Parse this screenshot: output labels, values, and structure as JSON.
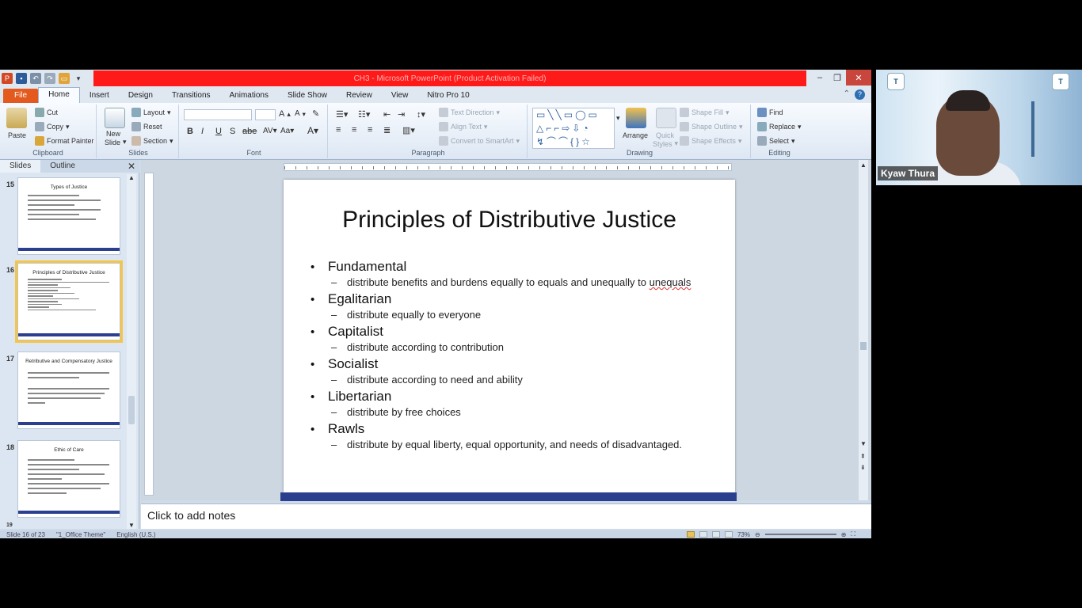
{
  "titlebar": {
    "title": "CH3 - Microsoft PowerPoint (Product Activation Failed)"
  },
  "tabs": [
    "File",
    "Home",
    "Insert",
    "Design",
    "Transitions",
    "Animations",
    "Slide Show",
    "Review",
    "View",
    "Nitro Pro 10"
  ],
  "ribbon": {
    "clipboard": {
      "label": "Clipboard",
      "paste": "Paste",
      "cut": "Cut",
      "copy": "Copy",
      "format_painter": "Format Painter"
    },
    "slides": {
      "label": "Slides",
      "new_slide_1": "New",
      "new_slide_2": "Slide",
      "layout": "Layout",
      "reset": "Reset",
      "section": "Section"
    },
    "font": {
      "label": "Font"
    },
    "paragraph": {
      "label": "Paragraph",
      "text_direction": "Text Direction",
      "align_text": "Align Text",
      "convert_smartart": "Convert to SmartArt"
    },
    "drawing": {
      "label": "Drawing",
      "arrange": "Arrange",
      "quick_styles_1": "Quick",
      "quick_styles_2": "Styles",
      "shape_fill": "Shape Fill",
      "shape_outline": "Shape Outline",
      "shape_effects": "Shape Effects"
    },
    "editing": {
      "label": "Editing",
      "find": "Find",
      "replace": "Replace",
      "select": "Select"
    }
  },
  "slides_panel": {
    "tab_slides": "Slides",
    "tab_outline": "Outline",
    "thumbnails": [
      {
        "number": "15",
        "title": "Types of Justice"
      },
      {
        "number": "16",
        "title": "Principles of Distributive Justice"
      },
      {
        "number": "17",
        "title": "Retributive and Compensatory Justice"
      },
      {
        "number": "18",
        "title": "Ethic of Care"
      },
      {
        "number": "19",
        "title": ""
      }
    ]
  },
  "slide": {
    "title": "Principles of Distributive Justice",
    "bullets": [
      {
        "head": "Fundamental",
        "sub": "distribute benefits and burdens equally to equals and unequally to ",
        "sub_flag": "unequals"
      },
      {
        "head": "Egalitarian",
        "sub": "distribute equally to everyone"
      },
      {
        "head": "Capitalist",
        "sub": "distribute according to contribution"
      },
      {
        "head": "Socialist",
        "sub": "distribute according to need and ability"
      },
      {
        "head": "Libertarian",
        "sub": "distribute by free choices"
      },
      {
        "head": "Rawls",
        "sub": "distribute by equal liberty, equal opportunity, and needs of disadvantaged."
      }
    ]
  },
  "notes": {
    "placeholder": "Click to add notes"
  },
  "statusbar": {
    "slide_info": "Slide 16 of 23",
    "theme": "\"1_Office Theme\"",
    "language": "English (U.S.)",
    "zoom": "73%"
  },
  "video": {
    "participant_name": "Kyaw Thura",
    "logo_text": "T"
  }
}
